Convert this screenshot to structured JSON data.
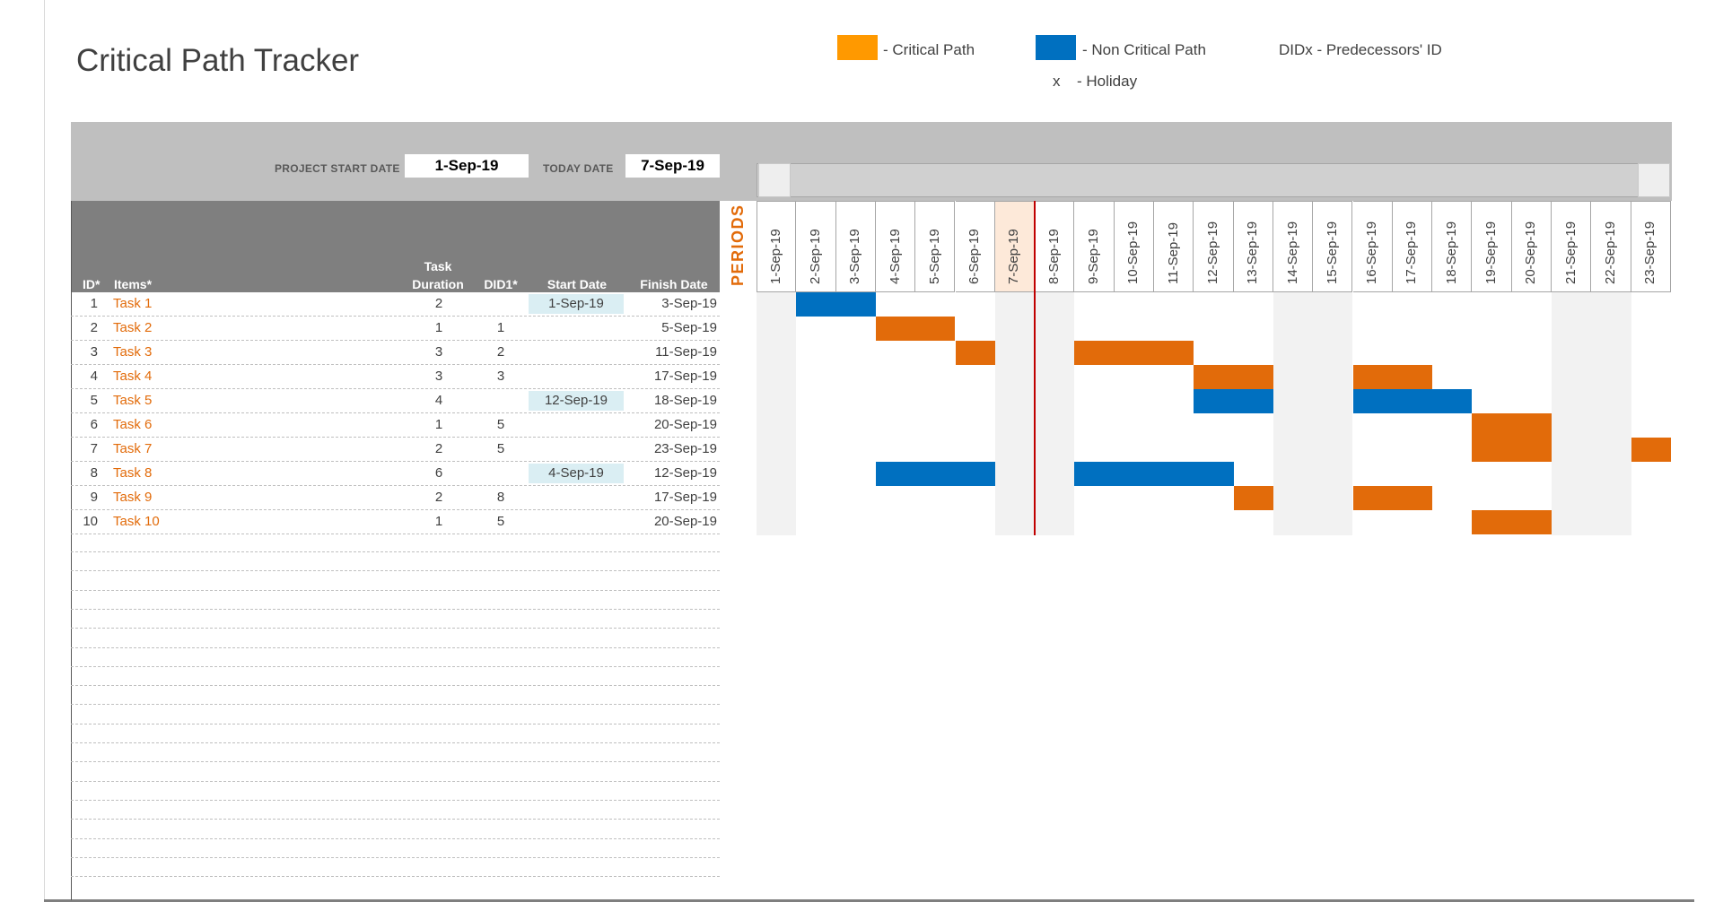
{
  "title": "Critical Path Tracker",
  "legend": {
    "critical_label": "- Critical Path",
    "critical_color": "#ff9900",
    "noncritical_label": "- Non Critical Path",
    "noncritical_color": "#0070c0",
    "didx_label": "DIDx - Predecessors' ID",
    "holiday_marker": "x",
    "holiday_label": "- Holiday"
  },
  "project": {
    "start_label": "PROJECT START DATE",
    "start_value": "1-Sep-19",
    "today_label": "TODAY DATE",
    "today_value": "7-Sep-19"
  },
  "columns": {
    "id": "ID*",
    "items": "Items*",
    "duration_line1": "Task",
    "duration_line2": "Duration",
    "did1": "DID1*",
    "start": "Start Date",
    "finish": "Finish Date"
  },
  "periods_label": "PERIODS",
  "tasks": [
    {
      "id": "1",
      "name": "Task 1",
      "duration": "2",
      "did1": "",
      "start": "1-Sep-19",
      "finish": "3-Sep-19"
    },
    {
      "id": "2",
      "name": "Task 2",
      "duration": "1",
      "did1": "1",
      "start": "",
      "finish": "5-Sep-19"
    },
    {
      "id": "3",
      "name": "Task 3",
      "duration": "3",
      "did1": "2",
      "start": "",
      "finish": "11-Sep-19"
    },
    {
      "id": "4",
      "name": "Task 4",
      "duration": "3",
      "did1": "3",
      "start": "",
      "finish": "17-Sep-19"
    },
    {
      "id": "5",
      "name": "Task 5",
      "duration": "4",
      "did1": "",
      "start": "12-Sep-19",
      "finish": "18-Sep-19"
    },
    {
      "id": "6",
      "name": "Task 6",
      "duration": "1",
      "did1": "5",
      "start": "",
      "finish": "20-Sep-19"
    },
    {
      "id": "7",
      "name": "Task 7",
      "duration": "2",
      "did1": "5",
      "start": "",
      "finish": "23-Sep-19"
    },
    {
      "id": "8",
      "name": "Task 8",
      "duration": "6",
      "did1": "",
      "start": "4-Sep-19",
      "finish": "12-Sep-19"
    },
    {
      "id": "9",
      "name": "Task 9",
      "duration": "2",
      "did1": "8",
      "start": "",
      "finish": "17-Sep-19"
    },
    {
      "id": "10",
      "name": "Task 10",
      "duration": "1",
      "did1": "5",
      "start": "",
      "finish": "20-Sep-19"
    }
  ],
  "dates": [
    "1-Sep-19",
    "2-Sep-19",
    "3-Sep-19",
    "4-Sep-19",
    "5-Sep-19",
    "6-Sep-19",
    "7-Sep-19",
    "8-Sep-19",
    "9-Sep-19",
    "10-Sep-19",
    "11-Sep-19",
    "12-Sep-19",
    "13-Sep-19",
    "14-Sep-19",
    "15-Sep-19",
    "16-Sep-19",
    "17-Sep-19",
    "18-Sep-19",
    "19-Sep-19",
    "20-Sep-19",
    "21-Sep-19",
    "22-Sep-19",
    "23-Sep-19"
  ],
  "today_index": 6,
  "weekend_indices": [
    0,
    6,
    7,
    13,
    14,
    20,
    21
  ],
  "bars": [
    {
      "row": 0,
      "start": 1,
      "days": 2,
      "type": "non"
    },
    {
      "row": 1,
      "start": 3,
      "days": 2,
      "type": "crit"
    },
    {
      "row": 2,
      "start": 5,
      "days": 1,
      "type": "crit"
    },
    {
      "row": 2,
      "start": 8,
      "days": 3,
      "type": "crit"
    },
    {
      "row": 3,
      "start": 11,
      "days": 2,
      "type": "crit"
    },
    {
      "row": 3,
      "start": 15,
      "days": 2,
      "type": "crit"
    },
    {
      "row": 4,
      "start": 11,
      "days": 2,
      "type": "non"
    },
    {
      "row": 4,
      "start": 15,
      "days": 3,
      "type": "non"
    },
    {
      "row": 5,
      "start": 18,
      "days": 2,
      "type": "crit"
    },
    {
      "row": 6,
      "start": 18,
      "days": 2,
      "type": "crit"
    },
    {
      "row": 6,
      "start": 22,
      "days": 1,
      "type": "crit"
    },
    {
      "row": 7,
      "start": 3,
      "days": 3,
      "type": "non"
    },
    {
      "row": 7,
      "start": 8,
      "days": 4,
      "type": "non"
    },
    {
      "row": 8,
      "start": 12,
      "days": 1,
      "type": "crit"
    },
    {
      "row": 8,
      "start": 15,
      "days": 2,
      "type": "crit"
    },
    {
      "row": 9,
      "start": 18,
      "days": 2,
      "type": "crit"
    }
  ]
}
